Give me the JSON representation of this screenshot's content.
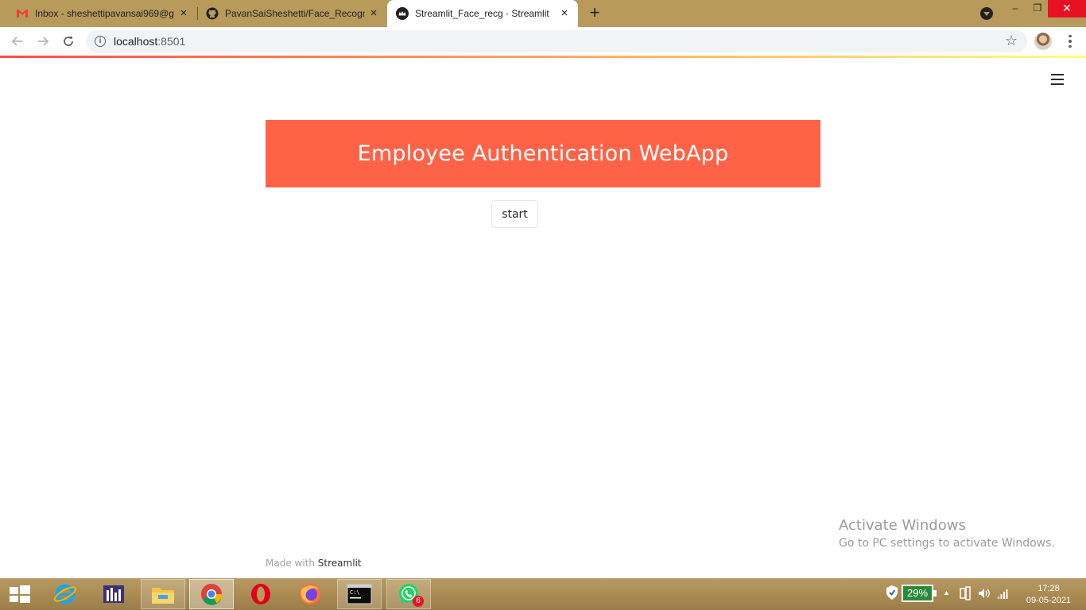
{
  "browser": {
    "tabs": [
      {
        "title": "Inbox - sheshettipavansai969@g",
        "favicon": "gmail-icon",
        "active": false
      },
      {
        "title": "PavanSaiSheshetti/Face_Recogni",
        "favicon": "github-icon",
        "active": false
      },
      {
        "title": "Streamlit_Face_recg · Streamlit",
        "favicon": "streamlit-icon",
        "active": true
      }
    ],
    "new_tab_label": "+",
    "address": {
      "host": "localhost",
      "port": ":8501"
    },
    "window_controls": {
      "minimize": "–",
      "maximize": "❐",
      "close": "✕"
    }
  },
  "app": {
    "title": "Employee Authentication WebApp",
    "title_bg_color": "#ff6347",
    "start_button_label": "start",
    "footer": {
      "prefix": "Made with ",
      "brand": "Streamlit"
    },
    "decoration_colors": [
      "#ff4b4b",
      "#fffd80"
    ]
  },
  "watermark": {
    "line1": "Activate Windows",
    "line2": "Go to PC settings to activate Windows."
  },
  "taskbar": {
    "apps": [
      {
        "name": "internet-explorer-icon",
        "running": false
      },
      {
        "name": "equalizer-app-icon",
        "running": false
      },
      {
        "name": "file-explorer-icon",
        "running": true
      },
      {
        "name": "chrome-icon",
        "running": true,
        "active": true
      },
      {
        "name": "opera-icon",
        "running": false
      },
      {
        "name": "firefox-icon",
        "running": false
      },
      {
        "name": "command-prompt-icon",
        "running": true
      },
      {
        "name": "whatsapp-icon",
        "running": true,
        "badge": "6"
      }
    ],
    "battery_percent": "29%",
    "time": "17:28",
    "date": "09-05-2021"
  }
}
